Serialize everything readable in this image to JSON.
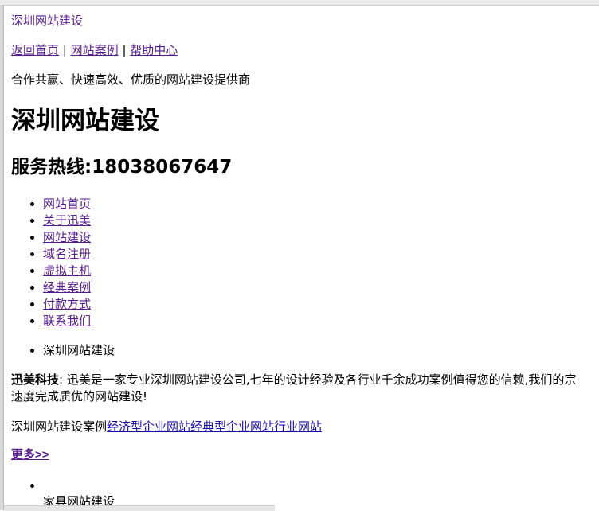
{
  "header": {
    "site_name_link": "深圳网站建设",
    "top_links": [
      "返回首页",
      "网站案例",
      "帮助中心"
    ],
    "separator": "|",
    "tagline": "合作共赢、快速高效、优质的网站建设提供商",
    "title": "深圳网站建设",
    "hotline": "服务热线:18038067647"
  },
  "nav": {
    "items": [
      "网站首页",
      "关于迅美",
      "网站建设",
      "域名注册",
      "虚拟主机",
      "经典案例",
      "付款方式",
      "联系我们"
    ]
  },
  "section": {
    "current_item": "深圳网站建设",
    "intro_bold": "迅美科技",
    "intro_line1": ": 迅美是一家专业深圳网站建设公司,七年的设计经验及各行业千余成功案例值得您的信赖,我们的宗",
    "intro_line2": "速度完成质优的网站建设!",
    "cases_prefix": "深圳网站建设案例",
    "case_links": [
      "经济型企业网站",
      "经典型企业网站",
      "行业网站"
    ],
    "more": "更多>>",
    "furniture": "家具网站建设"
  }
}
